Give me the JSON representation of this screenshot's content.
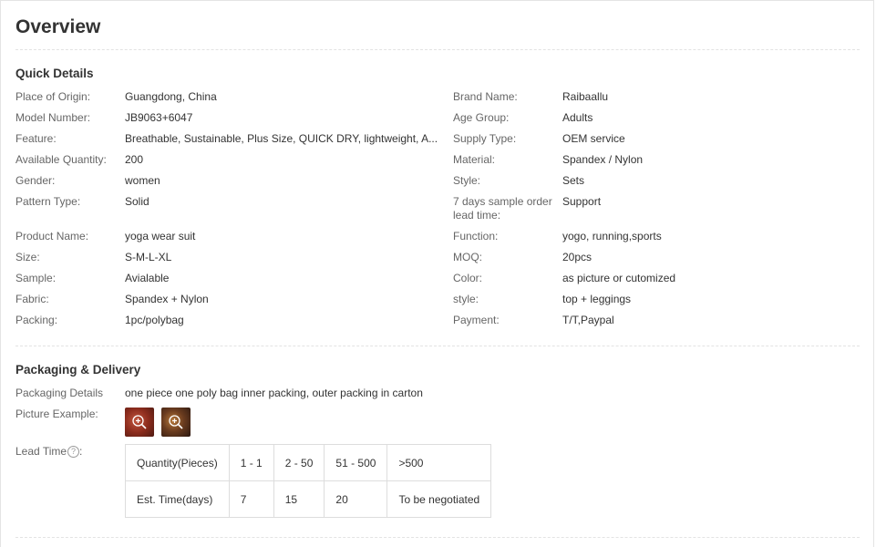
{
  "title": "Overview",
  "quick_details": {
    "heading": "Quick Details",
    "left": [
      {
        "label": "Place of Origin:",
        "value": "Guangdong, China"
      },
      {
        "label": "Model Number:",
        "value": "JB9063+6047"
      },
      {
        "label": "Feature:",
        "value": "Breathable, Sustainable, Plus Size, QUICK DRY, lightweight, A..."
      },
      {
        "label": "Available Quantity:",
        "value": "200"
      },
      {
        "label": "Gender:",
        "value": "women"
      },
      {
        "label": "Pattern Type:",
        "value": "Solid"
      },
      {
        "label": "Product Name:",
        "value": "yoga wear suit"
      },
      {
        "label": "Size:",
        "value": "S-M-L-XL"
      },
      {
        "label": "Sample:",
        "value": "Avialable"
      },
      {
        "label": "Fabric:",
        "value": "Spandex + Nylon"
      },
      {
        "label": "Packing:",
        "value": "1pc/polybag"
      }
    ],
    "right": [
      {
        "label": "Brand Name:",
        "value": "Raibaallu"
      },
      {
        "label": "Age Group:",
        "value": "Adults"
      },
      {
        "label": "Supply Type:",
        "value": "OEM service"
      },
      {
        "label": "Material:",
        "value": "Spandex / Nylon"
      },
      {
        "label": "Style:",
        "value": "Sets"
      },
      {
        "label": "7 days sample order lead time:",
        "value": "Support"
      },
      {
        "label": "Function:",
        "value": "yogo, running,sports"
      },
      {
        "label": "MOQ:",
        "value": "20pcs"
      },
      {
        "label": "Color:",
        "value": "as picture or cutomized"
      },
      {
        "label": "style:",
        "value": "top + leggings"
      },
      {
        "label": "Payment:",
        "value": "T/T,Paypal"
      }
    ]
  },
  "packaging": {
    "heading": "Packaging & Delivery",
    "details_label": "Packaging Details",
    "details_value": "one piece one poly bag inner packing, outer packing in carton",
    "picture_label": "Picture Example:",
    "picture_icon": "zoom-in-icon",
    "lead_time_label": "Lead Time",
    "lead_time_help": "?",
    "lead_time_colon": ":",
    "lead_table": {
      "row1": [
        "Quantity(Pieces)",
        "1 - 1",
        "2 - 50",
        "51 - 500",
        ">500"
      ],
      "row2": [
        "Est. Time(days)",
        "7",
        "15",
        "20",
        "To be negotiated"
      ]
    }
  }
}
